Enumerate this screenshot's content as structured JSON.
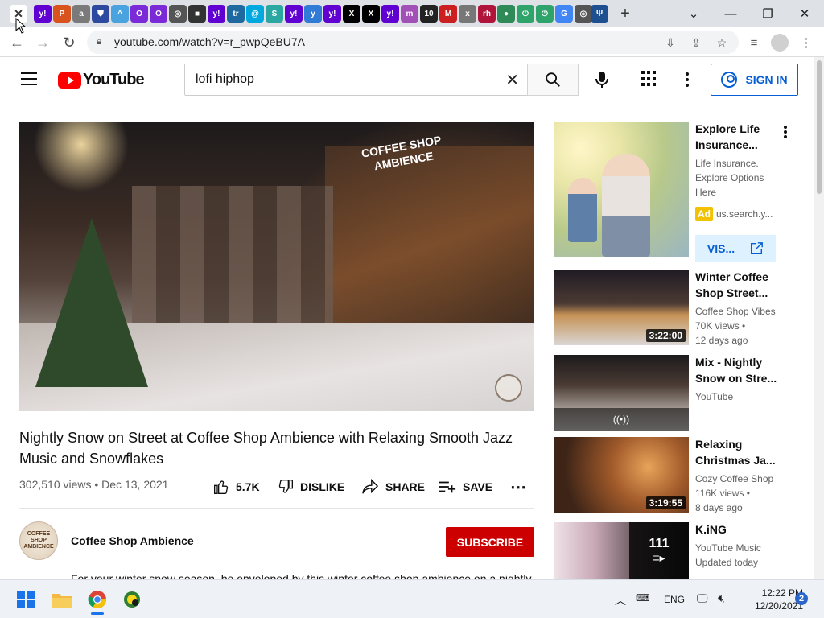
{
  "browser": {
    "tabs": [
      {
        "icon": "close-icon",
        "color": "#ffffff",
        "active": true
      },
      {
        "icon": "yahoo-icon",
        "color": "#6001d2",
        "glyph": "y!"
      },
      {
        "icon": "ps-icon",
        "color": "#d9531e",
        "glyph": "P"
      },
      {
        "icon": "asg-icon",
        "color": "#7a7a7a",
        "glyph": "a"
      },
      {
        "icon": "shield-icon",
        "color": "#2b4aa0",
        "glyph": "⛊"
      },
      {
        "icon": "arrow-up-icon",
        "color": "#4aa3df",
        "glyph": "^"
      },
      {
        "icon": "circle-o-icon",
        "color": "#7a2ad6",
        "glyph": "O"
      },
      {
        "icon": "circle-o-icon",
        "color": "#7a2ad6",
        "glyph": "O"
      },
      {
        "icon": "globe-icon",
        "color": "#555555",
        "glyph": "◎"
      },
      {
        "icon": "cube-icon",
        "color": "#333333",
        "glyph": "■"
      },
      {
        "icon": "yahoo-icon",
        "color": "#6001d2",
        "glyph": "y!"
      },
      {
        "icon": "trello-icon",
        "color": "#1e6aa0",
        "glyph": "tr"
      },
      {
        "icon": "att-icon",
        "color": "#00a8e0",
        "glyph": "@"
      },
      {
        "icon": "s-icon",
        "color": "#2aa7a0",
        "glyph": "S"
      },
      {
        "icon": "yahoo-icon",
        "color": "#6001d2",
        "glyph": "y!"
      },
      {
        "icon": "y-icon",
        "color": "#2f7bd6",
        "glyph": "y"
      },
      {
        "icon": "yahoo-icon",
        "color": "#6001d2",
        "glyph": "y!"
      },
      {
        "icon": "x-icon",
        "color": "#000000",
        "glyph": "X"
      },
      {
        "icon": "x-icon",
        "color": "#000000",
        "glyph": "X"
      },
      {
        "icon": "yahoo-icon",
        "color": "#6001d2",
        "glyph": "y!"
      },
      {
        "icon": "m-icon",
        "color": "#a34fb8",
        "glyph": "m"
      },
      {
        "icon": "ten-icon",
        "color": "#222222",
        "glyph": "10"
      },
      {
        "icon": "m-red-icon",
        "color": "#cc1f1f",
        "glyph": "M"
      },
      {
        "icon": "x-small-icon",
        "color": "#777777",
        "glyph": "x"
      },
      {
        "icon": "rh-icon",
        "color": "#b0143a",
        "glyph": "rh"
      },
      {
        "icon": "leaf-icon",
        "color": "#2e8b57",
        "glyph": "●"
      },
      {
        "icon": "power-icon",
        "color": "#2ea36a",
        "glyph": "⏻"
      },
      {
        "icon": "power-icon",
        "color": "#2ea36a",
        "glyph": "⏻"
      },
      {
        "icon": "google-icon",
        "color": "#4285f4",
        "glyph": "G"
      },
      {
        "icon": "globe-icon",
        "color": "#555555",
        "glyph": "◎"
      },
      {
        "icon": "psi-icon",
        "color": "#1d4f91",
        "glyph": "Ψ"
      }
    ],
    "url": "youtube.com/watch?v=r_pwpQeBU7A"
  },
  "header": {
    "logo_text": "YouTube",
    "search_value": "lofi hiphop",
    "signin_label": "SIGN IN"
  },
  "video": {
    "sign_line1": "COFFEE SHOP",
    "sign_line2": "AMBIENCE",
    "title": "Nightly Snow on Street at Coffee Shop Ambience with Relaxing Smooth Jazz Music and Snowflakes",
    "meta": "302,510 views • Dec 13, 2021",
    "like_count": "5.7K",
    "dislike_label": "DISLIKE",
    "share_label": "SHARE",
    "save_label": "SAVE",
    "channel_name": "Coffee Shop Ambience",
    "channel_avatar_text": "COFFEE SHOP AMBIENCE",
    "subscribe_label": "SUBSCRIBE",
    "description": "For your winter snow season, be enveloped by this winter coffee shop ambience on a nightly"
  },
  "sidebar": {
    "ad": {
      "title": "Explore Life Insurance...",
      "desc": "Life Insurance. Explore Options Here",
      "ad_label": "Ad",
      "domain": "us.search.y...",
      "visit_label": "VIS..."
    },
    "items": [
      {
        "title": "Winter Coffee Shop Street...",
        "channel": "Coffee Shop Vibes",
        "views": "70K views •",
        "age": "12 days ago",
        "duration": "3:22:00"
      },
      {
        "title": "Mix - Nightly Snow on Stre...",
        "channel": "YouTube",
        "views": "",
        "age": "",
        "duration": ""
      },
      {
        "title": "Relaxing Christmas Ja...",
        "channel": "Cozy Coffee Shop",
        "views": "116K views •",
        "age": "8 days ago",
        "duration": "3:19:55"
      },
      {
        "title": "K.iNG",
        "channel": "YouTube Music",
        "views": "Updated today",
        "age": "",
        "playlist_count": "111"
      }
    ]
  },
  "taskbar": {
    "lang": "ENG",
    "time": "12:22 PM",
    "date": "12/20/2021",
    "notifications": "2"
  }
}
